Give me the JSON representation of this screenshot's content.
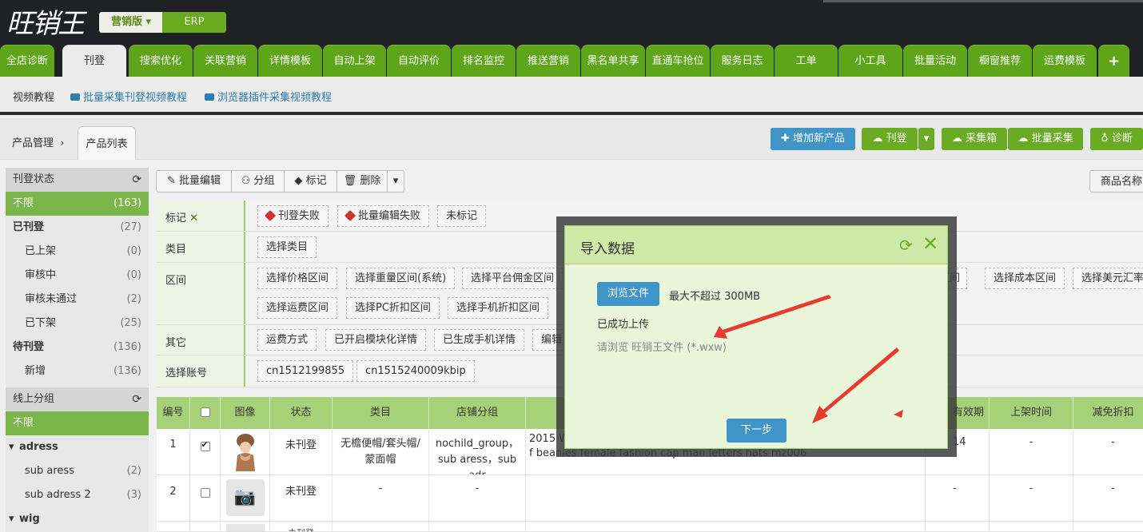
{
  "header": {
    "logo_text": "旺销王",
    "edition": "营销版",
    "erp": "ERP"
  },
  "nav": {
    "tabs": [
      "全店诊断",
      "刊登",
      "搜索优化",
      "关联营销",
      "详情模板",
      "自动上架",
      "自动评价",
      "排名监控",
      "推送营销",
      "黑名单共享",
      "直通车抢位",
      "服务日志",
      "工单",
      "小工具",
      "批量活动",
      "橱窗推荐",
      "运费模板",
      "+"
    ],
    "active": "刊登"
  },
  "subnav": {
    "video": "视频教程",
    "link1": "批量采集刊登视频教程",
    "link2": "浏览器插件采集视频教程"
  },
  "breadcrumb": {
    "parent": "产品管理",
    "current": "产品列表"
  },
  "actions": {
    "add": "增加新产品",
    "publish": "刊登",
    "collect_box": "采集箱",
    "batch_collect": "批量采集",
    "diagnose": "诊断",
    "product_name": "商品名称"
  },
  "sidebar": {
    "status_title": "刊登状态",
    "status_items": [
      {
        "label": "不限",
        "count": "(163)"
      },
      {
        "label": "已刊登",
        "count": "(27)"
      },
      {
        "label": "已上架",
        "count": "(0)"
      },
      {
        "label": "审核中",
        "count": "(0)"
      },
      {
        "label": "审核未通过",
        "count": "(2)"
      },
      {
        "label": "已下架",
        "count": "(25)"
      },
      {
        "label": "待刊登",
        "count": "(136)"
      },
      {
        "label": "新增",
        "count": "(136)"
      }
    ],
    "group_title": "线上分组",
    "group_items": [
      {
        "label": "不限",
        "count": ""
      },
      {
        "label": "adress",
        "count": ""
      },
      {
        "label": "sub aress",
        "count": "(2)"
      },
      {
        "label": "sub adress 2",
        "count": "(3)"
      },
      {
        "label": "wig",
        "count": ""
      }
    ]
  },
  "toolbar": {
    "batch_edit": "批量编辑",
    "group": "分组",
    "mark": "标记",
    "delete": "删除"
  },
  "filters": {
    "mark_label": "标记",
    "mark_chips": [
      "刊登失败",
      "批量编辑失败",
      "未标记"
    ],
    "category_label": "类目",
    "category_chips": [
      "选择类目"
    ],
    "range_label": "区间",
    "range_row1": [
      "选择价格区间",
      "选择重量区间(系统)",
      "选择平台佣金区间"
    ],
    "range_row1_right": [
      "区间",
      "选择成本区间",
      "选择美元汇率"
    ],
    "range_row2": [
      "选择运费区间",
      "选择PC折扣区间",
      "选择手机折扣区间"
    ],
    "other_label": "其它",
    "other_chips": [
      "运费方式",
      "已开启模块化详情",
      "已生成手机详情",
      "编辑"
    ],
    "account_label": "选择账号",
    "account_chips": [
      "cn1512199855",
      "cn1515240009kbip"
    ]
  },
  "table": {
    "headers": [
      "编号",
      "",
      "图像",
      "状态",
      "类目",
      "店铺分组",
      "",
      "有效期",
      "上架时间",
      "减免折扣"
    ],
    "rows": [
      {
        "no": "1",
        "status": "未刊登",
        "category": "无檐便帽/套头帽/蒙面帽",
        "group": "nochild_group，sub aress，sub adr",
        "group_extra": "-",
        "title_a": "2015 W",
        "title_b": "f beanies female fashion cap man letters hats mz006",
        "valid": "14",
        "time": "-",
        "discount": "-"
      },
      {
        "no": "2",
        "status": "未刊登",
        "category": "-",
        "group": "-",
        "valid": "-",
        "time": "-",
        "discount": "-"
      },
      {
        "no": "",
        "status": "未刊登"
      }
    ]
  },
  "modal": {
    "title": "导入数据",
    "browse": "浏览文件",
    "max_size": "最大不超过 300MB",
    "uploaded": "已成功上传",
    "hint": "请浏览 旺销王文件 (*.wxw)",
    "next": "下一步"
  },
  "colors": {
    "green": "#5ea51a",
    "blue": "#3f95c7",
    "arrow": "#e83a2e"
  }
}
